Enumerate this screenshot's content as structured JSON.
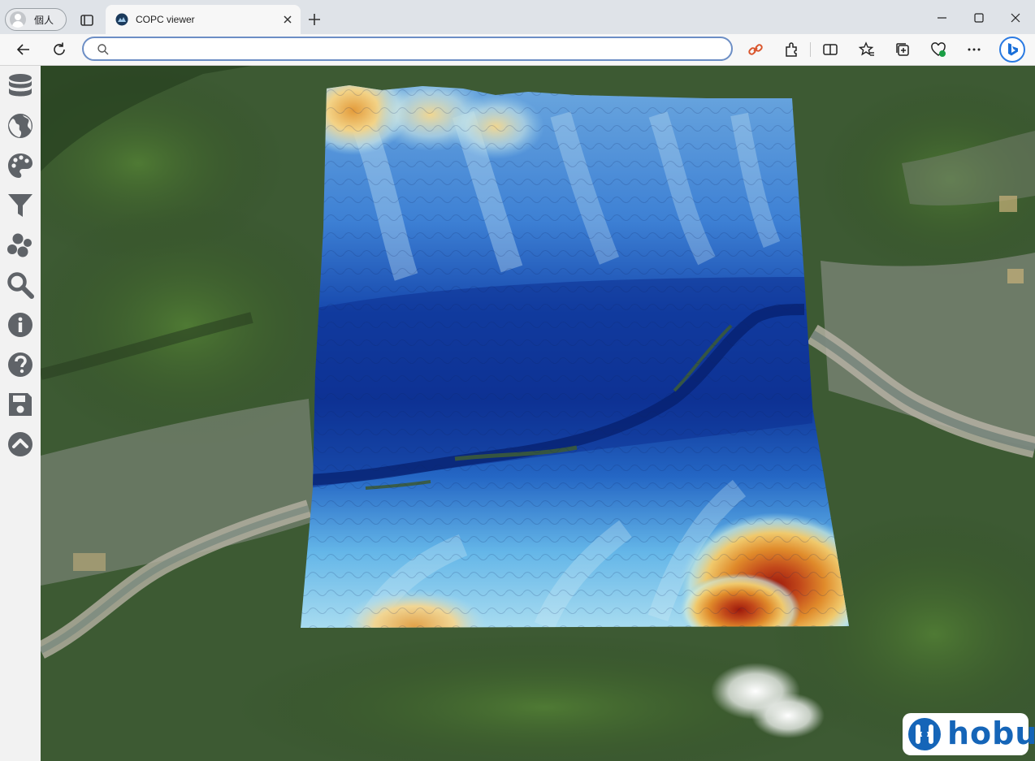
{
  "browser": {
    "profile_label": "個人",
    "tab_title": "COPC viewer",
    "address_value": "",
    "address_placeholder": ""
  },
  "sidebar": {
    "items": [
      {
        "icon": "database-icon",
        "name": "sidebar-item-data"
      },
      {
        "icon": "globe-icon",
        "name": "sidebar-item-globe"
      },
      {
        "icon": "palette-icon",
        "name": "sidebar-item-style"
      },
      {
        "icon": "filter-icon",
        "name": "sidebar-item-filter"
      },
      {
        "icon": "point-cloud-icon",
        "name": "sidebar-item-points"
      },
      {
        "icon": "search-icon",
        "name": "sidebar-item-search"
      },
      {
        "icon": "info-icon",
        "name": "sidebar-item-info"
      },
      {
        "icon": "help-icon",
        "name": "sidebar-item-help"
      },
      {
        "icon": "save-icon",
        "name": "sidebar-item-save"
      },
      {
        "icon": "chevron-up-icon",
        "name": "sidebar-item-collapse"
      }
    ]
  },
  "logo": {
    "text": "hobu",
    "color": "#1565b8"
  },
  "colors": {
    "sidebar_icon": "#5f6368",
    "address_border": "#6c8ec5",
    "elevation_low": "#0a2a8c",
    "elevation_mid": "#6ec3ef",
    "elevation_high": "#b4260f"
  }
}
